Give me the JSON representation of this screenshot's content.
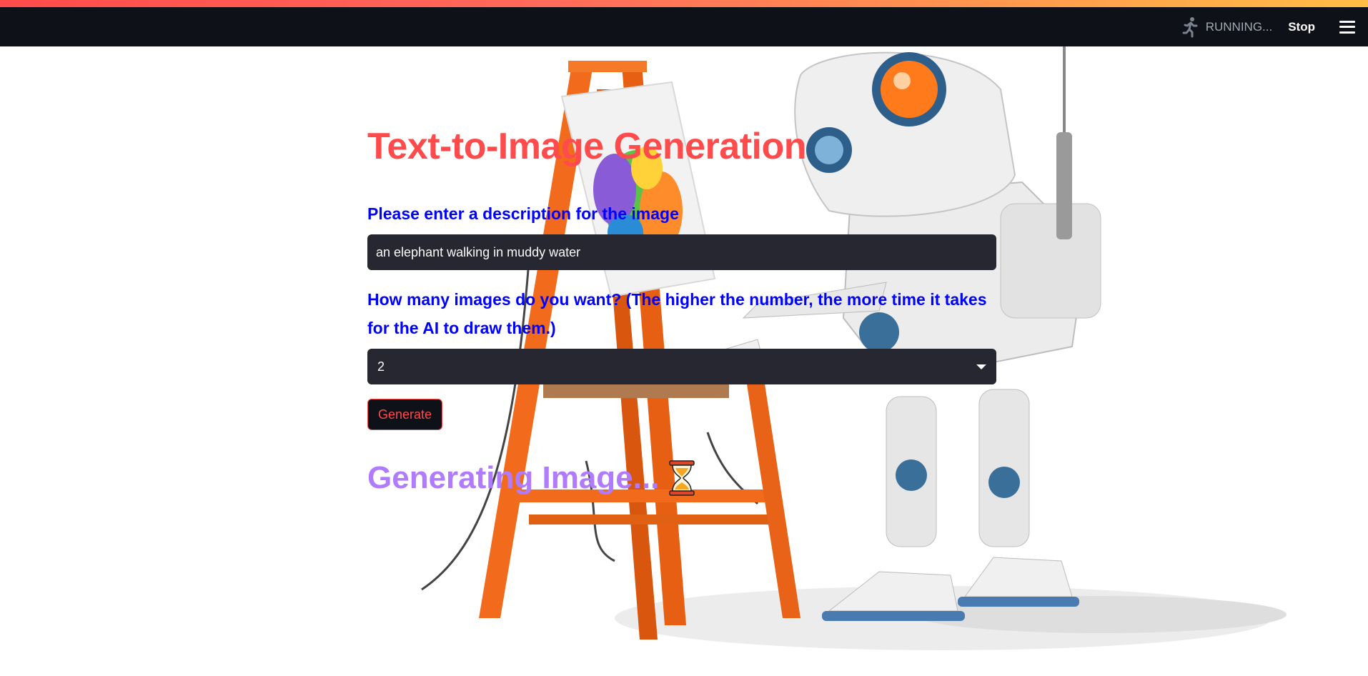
{
  "header": {
    "status_text": "RUNNING...",
    "stop_label": "Stop",
    "running_icon": "running-man-icon",
    "menu_icon": "hamburger-menu-icon"
  },
  "main": {
    "title": "Text-to-Image Generation",
    "description_label": "Please enter a description for the image",
    "description_value": "an elephant walking in muddy water",
    "count_label": "How many images do you want? (The higher the number, the more time it takes for the AI to draw them.)",
    "count_value": "2",
    "generate_label": "Generate",
    "status_text": "Generating Image...",
    "status_icon": "hourglass-icon"
  },
  "colors": {
    "accent": "#ff4b4b",
    "label_blue": "#0000ff",
    "status_purple": "#b07bff",
    "header_bg": "#0e1117",
    "input_bg": "#262730"
  }
}
